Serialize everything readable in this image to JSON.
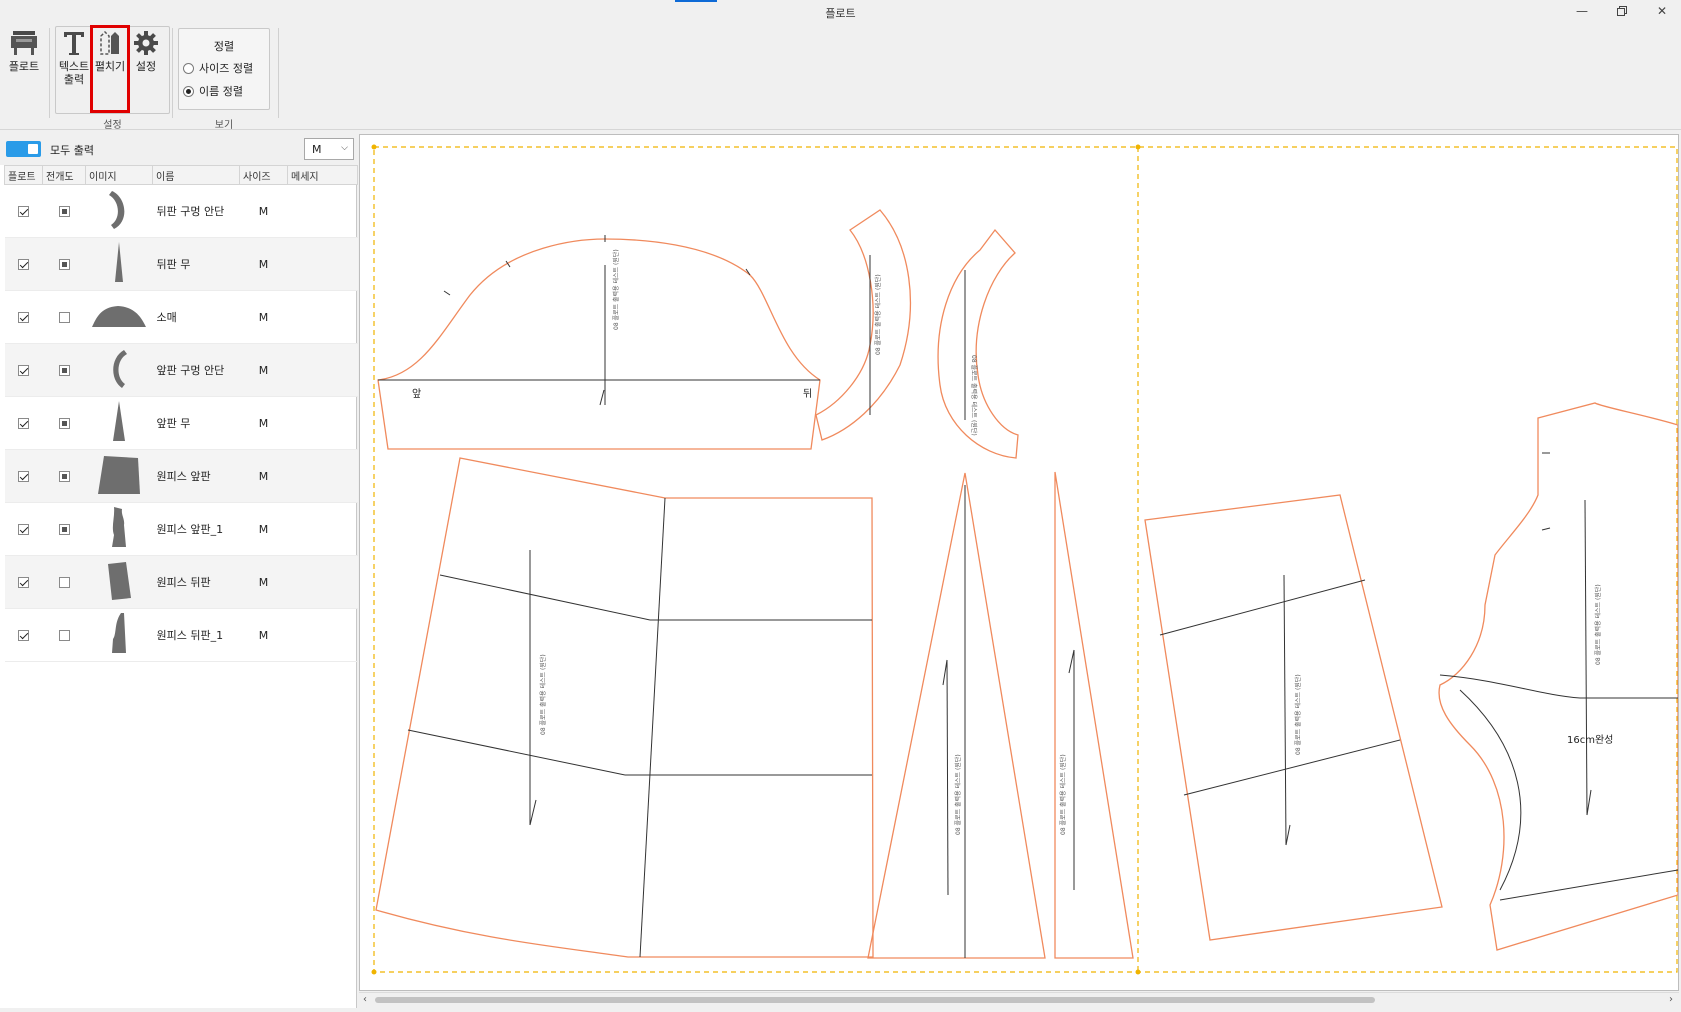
{
  "window": {
    "title": "플로트",
    "minimize_icon": "minimize-icon",
    "restore_icon": "restore-icon",
    "close_icon": "close-icon"
  },
  "ribbon": {
    "plot_label": "플로트",
    "text_label_line1": "텍스트",
    "text_label_line2": "출력",
    "unfold_label": "펼치기",
    "settings_label": "설정",
    "group_settings_label": "설정",
    "sort": {
      "title": "정렬",
      "size_sort": "사이즈 정렬",
      "name_sort": "이름 정렬",
      "selected": "name"
    },
    "group_view_label": "보기"
  },
  "left_panel": {
    "all_print_label": "모두 출력",
    "size_value": "M",
    "columns": [
      "플로트",
      "전개도",
      "이미지",
      "이름",
      "사이즈",
      "메세지"
    ],
    "rows": [
      {
        "plot": true,
        "unfold": "partial",
        "name": "뒤판 구멍 안단",
        "size": "M",
        "message": "",
        "thumb": "back-neck-facing"
      },
      {
        "plot": true,
        "unfold": "partial",
        "name": "뒤판 무",
        "size": "M",
        "message": "",
        "thumb": "back-gore"
      },
      {
        "plot": true,
        "unfold": "none",
        "name": "소매",
        "size": "M",
        "message": "",
        "thumb": "sleeve"
      },
      {
        "plot": true,
        "unfold": "partial",
        "name": "앞판 구멍 안단",
        "size": "M",
        "message": "",
        "thumb": "front-neck-facing"
      },
      {
        "plot": true,
        "unfold": "partial",
        "name": "앞판 무",
        "size": "M",
        "message": "",
        "thumb": "front-gore"
      },
      {
        "plot": true,
        "unfold": "partial",
        "name": "원피스 앞판",
        "size": "M",
        "message": "",
        "thumb": "dress-front"
      },
      {
        "plot": true,
        "unfold": "partial",
        "name": "원피스 앞판_1",
        "size": "M",
        "message": "",
        "thumb": "dress-front-1"
      },
      {
        "plot": true,
        "unfold": "none",
        "name": "원피스 뒤판",
        "size": "M",
        "message": "",
        "thumb": "dress-back"
      },
      {
        "plot": true,
        "unfold": "none",
        "name": "원피스 뒤판_1",
        "size": "M",
        "message": "",
        "thumb": "dress-back-1"
      }
    ]
  },
  "canvas": {
    "sleeve_left_label": "앞",
    "sleeve_right_label": "뒤",
    "annotation": "16cm완성",
    "colors": {
      "pattern_outline": "#f08a5d",
      "guide_line": "#333333",
      "page_border": "#f0b400"
    }
  }
}
